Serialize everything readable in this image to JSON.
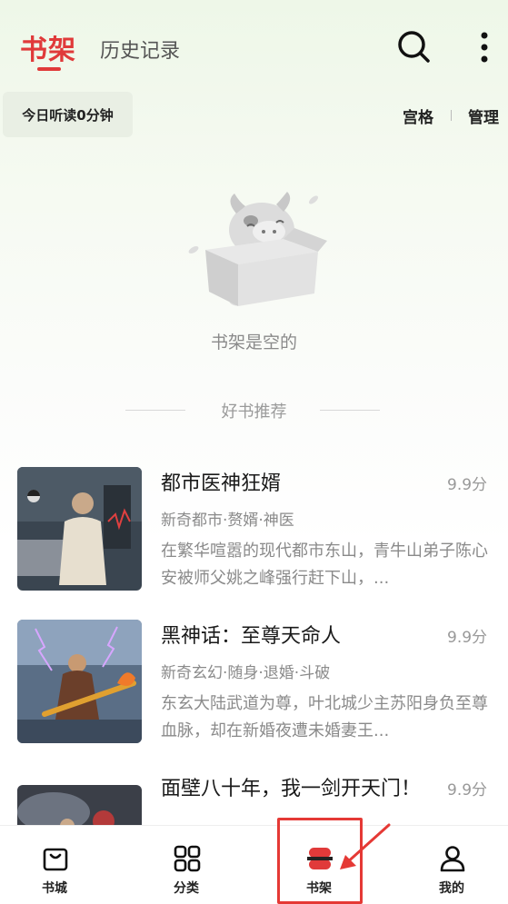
{
  "header": {
    "tabs": [
      {
        "label": "书架",
        "active": true
      },
      {
        "label": "历史记录",
        "active": false
      }
    ],
    "icons": [
      "search-icon",
      "more-vertical-icon"
    ]
  },
  "subbar": {
    "listen_today": "今日听读0分钟",
    "grid_label": "宫格",
    "manage_label": "管理"
  },
  "empty_state": {
    "message": "书架是空的"
  },
  "recommend": {
    "title": "好书推荐",
    "books": [
      {
        "title": "都市医神狂婿",
        "score": "9.9分",
        "tags": "新奇都市·赘婿·神医",
        "desc": "在繁华喧嚣的现代都市东山，青牛山弟子陈心安被师父姚之峰强行赶下山，..."
      },
      {
        "title": "黑神话：至尊天命人",
        "score": "9.9分",
        "tags": "新奇玄幻·随身·退婚·斗破",
        "desc": "东玄大陆武道为尊，叶北城少主苏阳身负至尊血脉，却在新婚夜遭未婚妻王..."
      },
      {
        "title": "面壁八十年，我一剑开天门！",
        "score": "9.9分",
        "tags": "",
        "desc": ""
      }
    ]
  },
  "bottom_nav": [
    {
      "label": "书城",
      "icon": "bag-icon",
      "active": false
    },
    {
      "label": "分类",
      "icon": "grid-icon",
      "active": false
    },
    {
      "label": "书架",
      "icon": "bookshelf-icon",
      "active": true
    },
    {
      "label": "我的",
      "icon": "user-icon",
      "active": false
    }
  ],
  "colors": {
    "accent": "#e03a3a",
    "annotation": "#e53935"
  }
}
